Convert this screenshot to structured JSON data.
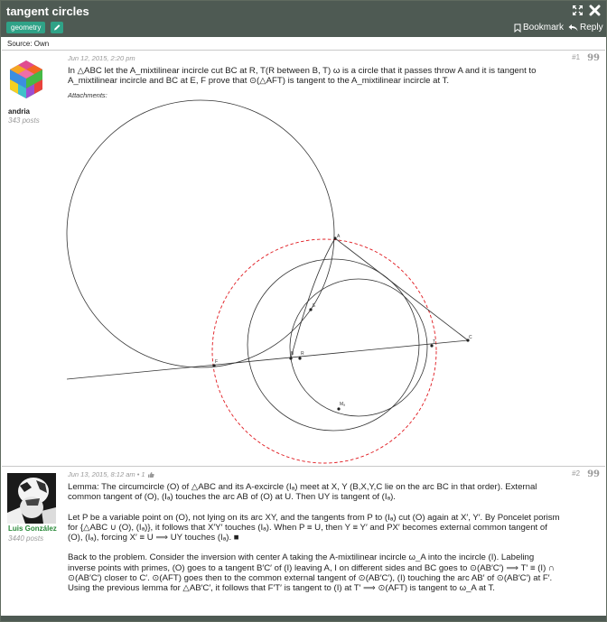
{
  "topic": {
    "title": "tangent circles",
    "tag": "geometry",
    "bookmark_label": "Bookmark",
    "reply_label": "Reply",
    "source": "Source: Own"
  },
  "colors": {
    "topbar": "#4e5a53",
    "tag": "#2fa287",
    "green_name": "#2a8a3a",
    "dashed_circle": "#e0181e"
  },
  "posts": [
    {
      "username": "andria",
      "postcount": "343 posts",
      "date": "Jun 12, 2015, 2:20 pm",
      "number": "#1",
      "text": "In △ABC let the A_mixtilinear incircle cut BC at R, T(R between B, T) ω is a circle that it passes throw A and it is tangent to A_mixtilinear incircle and BC at E, F prove that ⊙(△AFT) is tangent to the A_mixtilinear incircle at T.",
      "attachments_label": "Attachments:",
      "figure_labels": {
        "A": "A",
        "B": "B",
        "R": "R",
        "T": "T",
        "C": "C",
        "F": "F",
        "E": "E",
        "Ma": "Mₐ"
      }
    },
    {
      "username": "Luis González",
      "postcount": "3440 posts",
      "date": "Jun 13, 2015, 8:12 am • 1",
      "number": "#2",
      "para1": "Lemma: The circumcircle (O) of △ABC and its A-excircle (Iₐ) meet at X, Y (B,X,Y,C lie on the arc BC in that order). External common tangent of (O), (Iₐ) touches the arc AB of (O) at U. Then UY is tangent of (Iₐ).",
      "para2": "Let P be a variable point on (O), not lying on its arc XY, and the tangents from P to (Iₐ) cut (O) again at X′, Y′. By Poncelet porism for {△ABC ∪ (O), (Iₐ)}, it follows that X′Y′ touches (Iₐ). When P ≡ U, then Y ≡ Y′ and PX′ becomes external common tangent of (O), (Iₐ), forcing X′ ≡ U ⟹ UY touches (Iₐ). ■",
      "para3": "Back to the problem. Consider the inversion with center A taking the A-mixtilinear incircle ω_A into the incircle (I). Labeling inverse points with primes, (O) goes to a tangent B′C′ of (I) leaving A, I on different sides and BC goes to ⊙(AB′C′) ⟹ T′ ≡ (I) ∩ ⊙(AB′C′) closer to C′. ⊙(AFT) goes then to the common external tangent of ⊙(AB′C′), (I) touching the arc AB′ of ⊙(AB′C′) at F′. Using the previous lemma for △AB′C′, it follows that F′T′ is tangent to (I) at T′ ⟹ ⊙(AFT) is tangent to ω_A at T."
    }
  ]
}
